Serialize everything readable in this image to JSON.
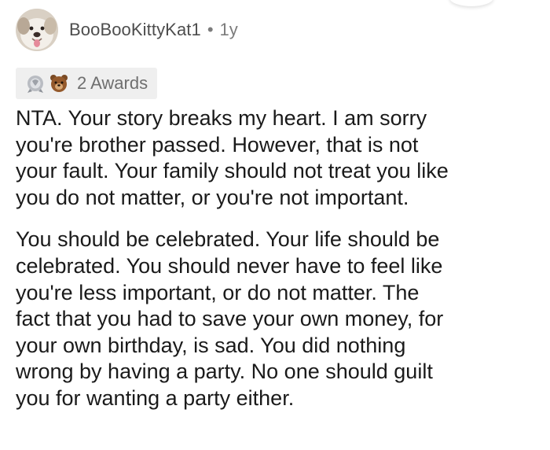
{
  "comment": {
    "username": "BooBooKittyKat1",
    "separator": "•",
    "age": "1y",
    "avatar_icon": "dog-avatar-icon",
    "awards": {
      "icons": [
        "silver-award-icon",
        "bear-award-icon"
      ],
      "label": "2 Awards"
    },
    "paragraphs": [
      "NTA. Your story breaks my heart. I am sorry\nyou're brother passed. However, that is not\nyour fault. Your family should not treat you like\nyou do not matter, or you're not important.",
      "You should be celebrated. Your life should be\ncelebrated. You should never have to feel like\nyou're less important, or do not matter. The\nfact that you had to save your own money, for\nyour own birthday, is sad. You did nothing\nwrong by having a party. No one should guilt\nyou for wanting a party either."
    ]
  },
  "colors": {
    "username": "#4d4d4d",
    "meta": "#7c7c7c",
    "awards_bg": "#efefef",
    "body_text": "#1a1a1a"
  }
}
